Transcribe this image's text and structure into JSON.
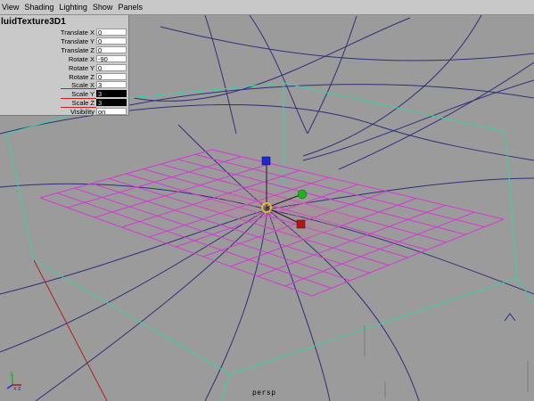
{
  "menubar": {
    "items": [
      "View",
      "Shading",
      "Lighting",
      "Show",
      "Panels"
    ]
  },
  "channel_box": {
    "node_name": "luidTexture3D1",
    "channels": [
      {
        "label": "Translate X",
        "value": "0"
      },
      {
        "label": "Translate Y",
        "value": "0"
      },
      {
        "label": "Translate Z",
        "value": "0"
      },
      {
        "label": "Rotate X",
        "value": "-90"
      },
      {
        "label": "Rotate Y",
        "value": "0"
      },
      {
        "label": "Rotate Z",
        "value": "0"
      },
      {
        "label": "Scale X",
        "value": "3"
      },
      {
        "label": "Scale Y",
        "value": "3"
      },
      {
        "label": "Scale Z",
        "value": "3"
      },
      {
        "label": "Visibility",
        "value": "on"
      }
    ]
  },
  "viewport": {
    "camera_label": "persp",
    "axis_labels": {
      "y": "y",
      "x": "x",
      "z": "z"
    }
  },
  "colors": {
    "background": "#9b9b9b",
    "grid_lines": "#2f2f7a",
    "bounding_box": "#39d3a0",
    "fluid_grid": "#d33ad3",
    "inner_grid": "#c27a9a",
    "manip_x": "#b01818",
    "manip_y": "#1c2ad0",
    "manip_z": "#22b022",
    "manip_center": "#e0c020"
  }
}
